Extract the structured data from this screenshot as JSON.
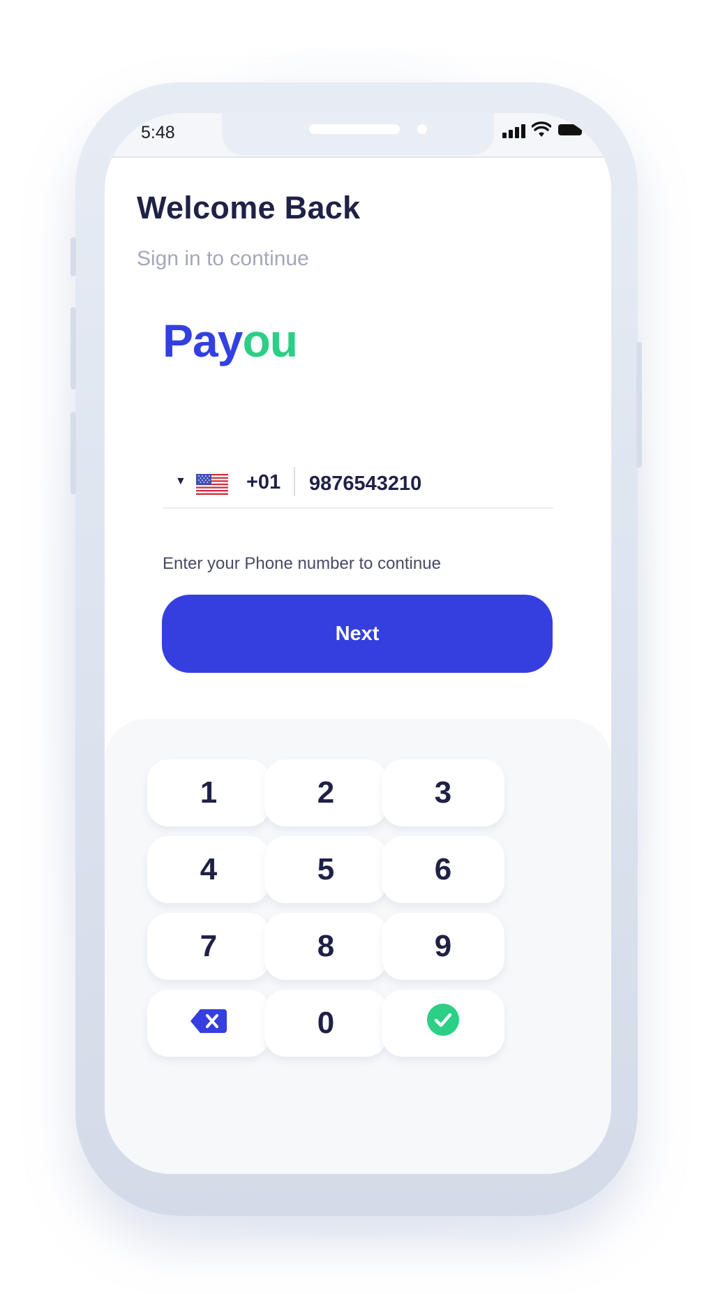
{
  "status_bar": {
    "time": "5:48"
  },
  "header": {
    "title": "Welcome Back",
    "subtitle": "Sign in to continue"
  },
  "logo": {
    "part1": "Pay",
    "part2": "ou"
  },
  "phone": {
    "country_code": "+01",
    "number": "9876543210",
    "flag": "us-flag-icon",
    "hint": "Enter your Phone number to continue"
  },
  "actions": {
    "next_label": "Next"
  },
  "keypad": {
    "keys": [
      "1",
      "2",
      "3",
      "4",
      "5",
      "6",
      "7",
      "8",
      "9"
    ],
    "zero": "0",
    "backspace_icon": "backspace-icon",
    "confirm_icon": "check-circle-icon"
  },
  "colors": {
    "primary": "#353fdf",
    "accent_green": "#2ccf86",
    "text_dark": "#1f2146",
    "text_muted": "#a5a8b8"
  }
}
